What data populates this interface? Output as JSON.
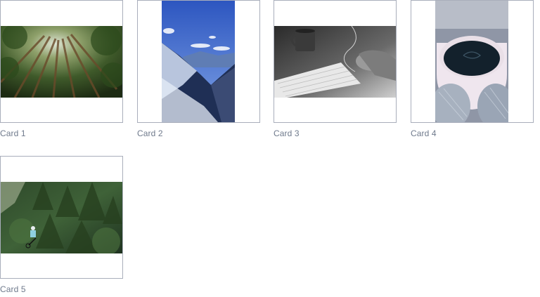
{
  "cards": [
    {
      "caption": "Card 1",
      "image": "forest-canopy-photo"
    },
    {
      "caption": "Card 2",
      "image": "mountain-valley-photo"
    },
    {
      "caption": "Card 3",
      "image": "desk-keyboard-mug-photo"
    },
    {
      "caption": "Card 4",
      "image": "coffee-cup-in-hands-photo"
    },
    {
      "caption": "Card 5",
      "image": "forest-rider-photo"
    }
  ]
}
